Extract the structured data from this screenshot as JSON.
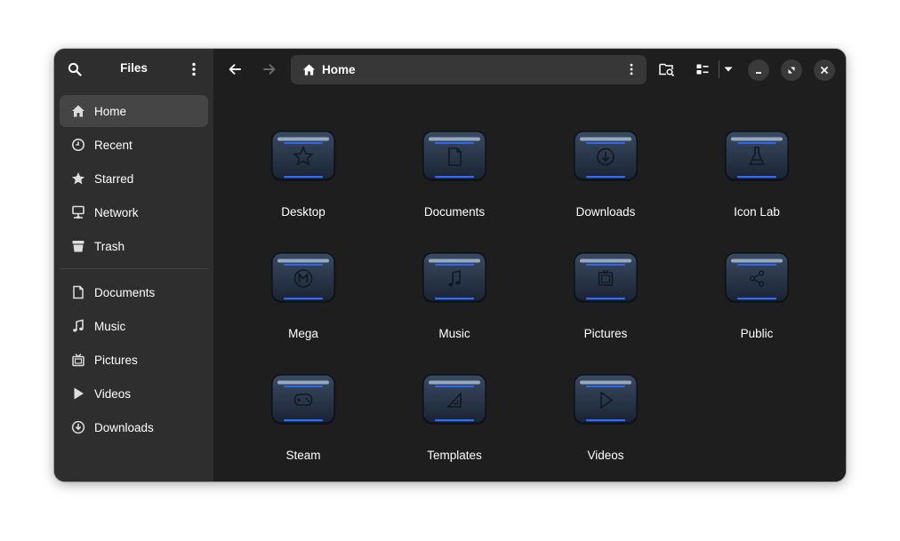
{
  "sidebar": {
    "title": "Files",
    "items": [
      {
        "label": "Home",
        "icon": "home-icon",
        "active": true
      },
      {
        "label": "Recent",
        "icon": "clock-icon"
      },
      {
        "label": "Starred",
        "icon": "star-icon"
      },
      {
        "label": "Network",
        "icon": "network-icon"
      },
      {
        "label": "Trash",
        "icon": "trash-icon"
      }
    ],
    "places": [
      {
        "label": "Documents",
        "icon": "document-icon"
      },
      {
        "label": "Music",
        "icon": "music-note-icon"
      },
      {
        "label": "Pictures",
        "icon": "picture-icon"
      },
      {
        "label": "Videos",
        "icon": "play-icon"
      },
      {
        "label": "Downloads",
        "icon": "download-icon"
      }
    ]
  },
  "header": {
    "path": "Home"
  },
  "folders": [
    {
      "label": "Desktop",
      "emblem": "star"
    },
    {
      "label": "Documents",
      "emblem": "document"
    },
    {
      "label": "Downloads",
      "emblem": "download"
    },
    {
      "label": "Icon Lab",
      "emblem": "flask"
    },
    {
      "label": "Mega",
      "emblem": "mega"
    },
    {
      "label": "Music",
      "emblem": "music"
    },
    {
      "label": "Pictures",
      "emblem": "picture"
    },
    {
      "label": "Public",
      "emblem": "share"
    },
    {
      "label": "Steam",
      "emblem": "gamepad"
    },
    {
      "label": "Templates",
      "emblem": "template"
    },
    {
      "label": "Videos",
      "emblem": "play"
    }
  ],
  "colors": {
    "accent_glow": "#2f6bff",
    "folder_body": "#1f2a3a",
    "sidebar_bg": "#2e2e2e",
    "content_bg": "#1e1e1e"
  }
}
